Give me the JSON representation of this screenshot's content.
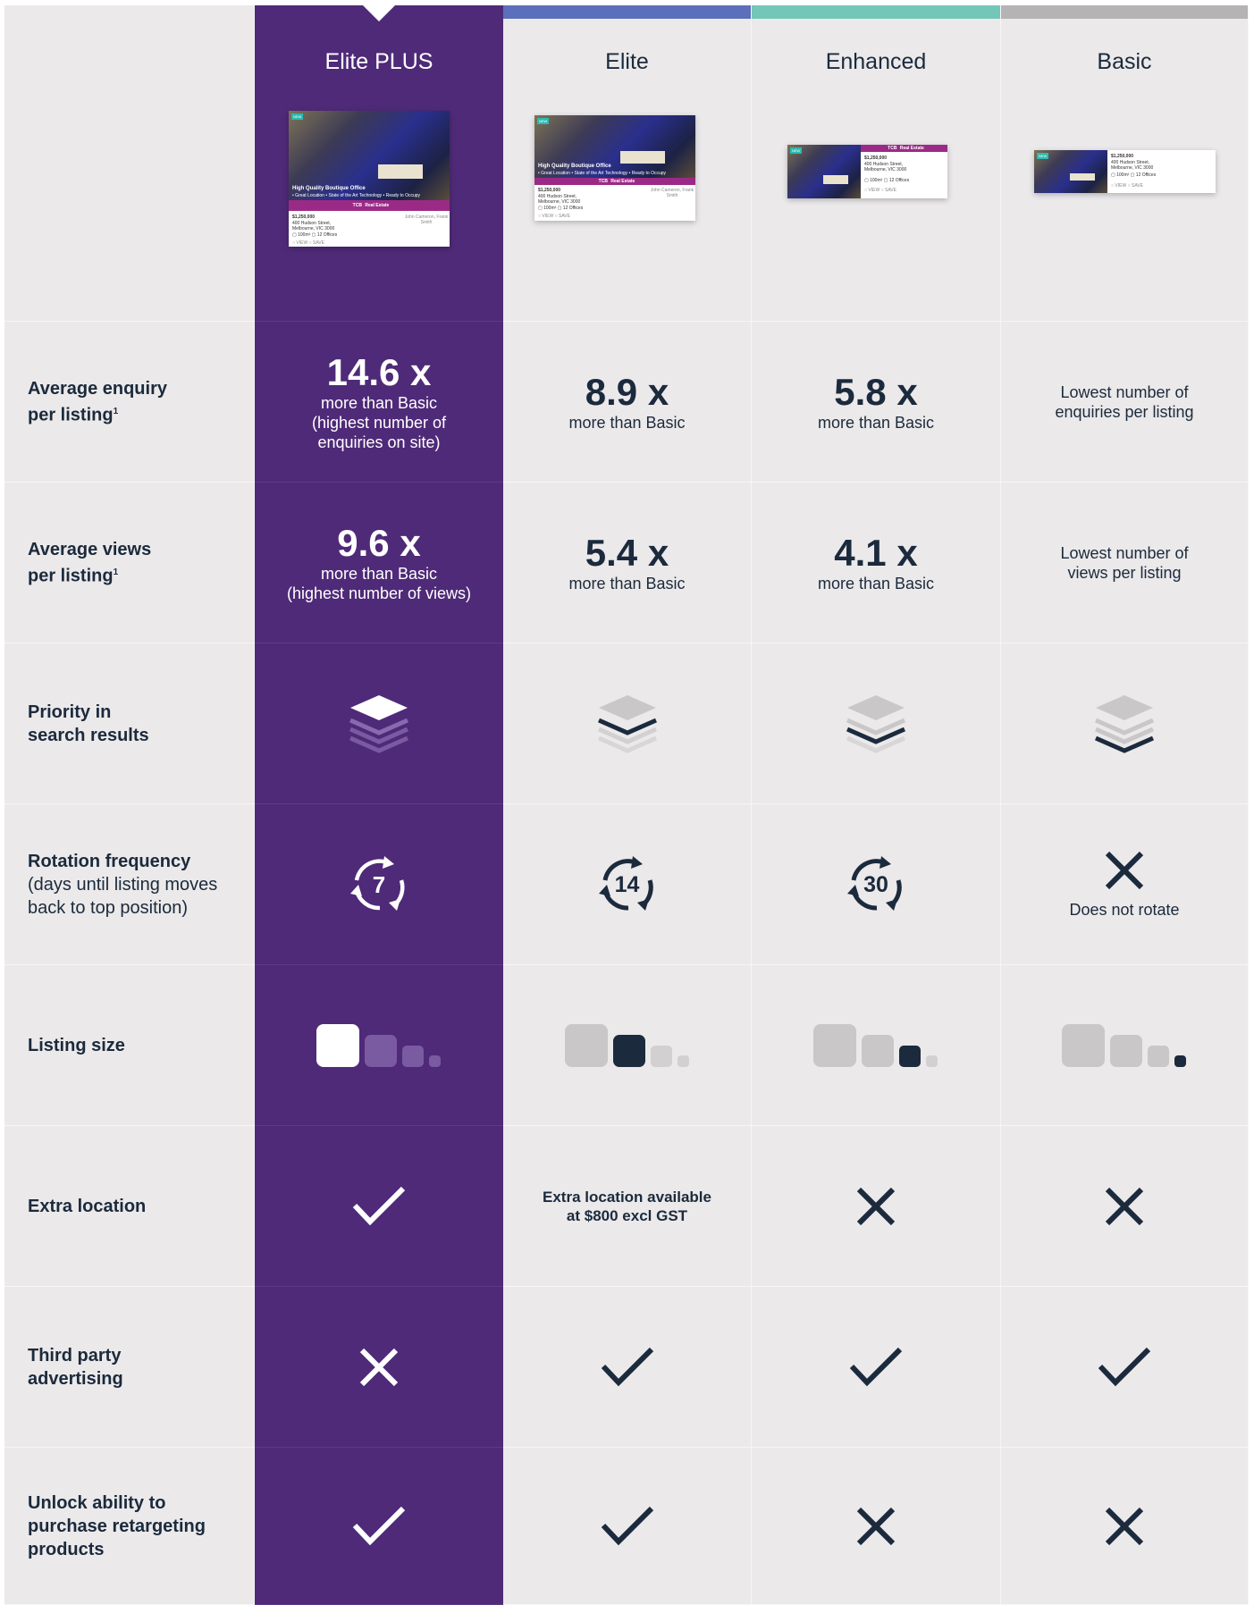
{
  "tiers": [
    {
      "name": "Elite PLUS",
      "color": "#4f2a78"
    },
    {
      "name": "Elite",
      "color": "#5b6fba"
    },
    {
      "name": "Enhanced",
      "color": "#73c6b8"
    },
    {
      "name": "Basic",
      "color": "#b5b3b4"
    }
  ],
  "listing_card": {
    "new_tag": "NEW",
    "title": "High Quality Boutique Office",
    "features": "• Great Location  • State of the Art Technology  • Ready to Occupy",
    "brand": "TCB",
    "brand_name": "Real Estate",
    "price": "$1,250,000",
    "address_line1": "400 Hudson Street,",
    "address_line2": "Melbourne, VIC 3000",
    "specs": "▢ 100m²   ▢ 12   Offices",
    "actions": "○ VIEW   ○ SAVE",
    "agents": "John Cameron, Frank Smith"
  },
  "rows": {
    "enquiry": {
      "label": "Average enquiry per listing",
      "sup": "1",
      "elite_plus": {
        "value": "14.6 x",
        "line1": "more than Basic",
        "line2": "(highest number of",
        "line3": "enquiries on site)"
      },
      "elite": {
        "value": "8.9 x",
        "line1": "more than Basic"
      },
      "enhanced": {
        "value": "5.8 x",
        "line1": "more than Basic"
      },
      "basic": {
        "line1": "Lowest number of",
        "line2": "enquiries per listing"
      }
    },
    "views": {
      "label": "Average views per listing",
      "sup": "1",
      "elite_plus": {
        "value": "9.6 x",
        "line1": "more than Basic",
        "line2": "(highest number of views)"
      },
      "elite": {
        "value": "5.4 x",
        "line1": "more than Basic"
      },
      "enhanced": {
        "value": "4.1 x",
        "line1": "more than Basic"
      },
      "basic": {
        "line1": "Lowest number of",
        "line2": "views per listing"
      }
    },
    "priority": {
      "label_line1": "Priority in",
      "label_line2": "search results",
      "icon": "stack-layers-icon"
    },
    "rotation": {
      "label": "Rotation frequency",
      "sub_line1": "(days until listing moves",
      "sub_line2": "back to top position)",
      "elite_plus": "7",
      "elite": "14",
      "enhanced": "30",
      "basic": "Does not rotate"
    },
    "size": {
      "label": "Listing size",
      "icon": "size-squares-icon"
    },
    "extra_location": {
      "label": "Extra location",
      "elite_line1": "Extra location available",
      "elite_line2": "at $800 excl GST"
    },
    "third_party": {
      "label_line1": "Third party",
      "label_line2": "advertising"
    },
    "retargeting": {
      "label_line1": "Unlock ability to",
      "label_line2": "purchase retargeting",
      "label_line3": "products"
    }
  },
  "colors": {
    "elite_plus_bg": "#4f2a78",
    "cell_bg": "#ebe9ea",
    "text_dark": "#1b2a3c",
    "inactive_icon": "#c9c7c8"
  }
}
